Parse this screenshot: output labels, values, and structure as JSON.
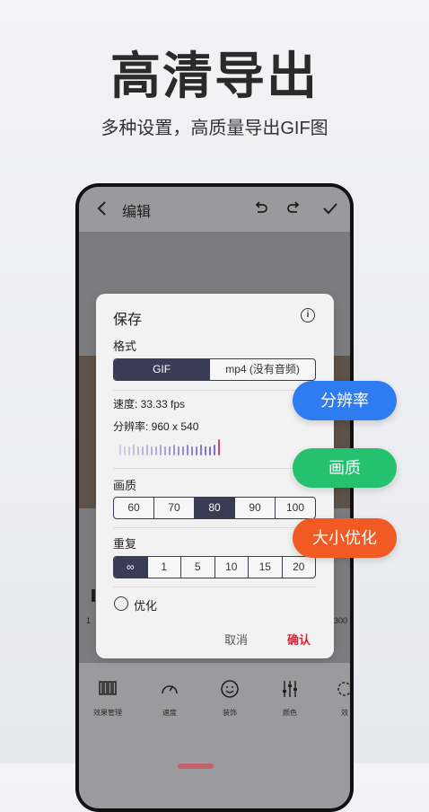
{
  "headline": "高清导出",
  "subheadline": "多种设置，高质量导出GIF图",
  "editor": {
    "title": "编辑",
    "back_icon": "chevron-left-icon",
    "undo_icon": "undo-icon",
    "redo_icon": "redo-icon",
    "confirm_icon": "check-icon",
    "range_start": "1",
    "range_end": "300",
    "tools": [
      {
        "label": "效果管理",
        "icon": "film-strip-icon"
      },
      {
        "label": "速度",
        "icon": "speedometer-icon"
      },
      {
        "label": "装饰",
        "icon": "smiley-icon"
      },
      {
        "label": "颜色",
        "icon": "sliders-icon"
      },
      {
        "label": "效",
        "icon": "effect-icon"
      }
    ]
  },
  "dialog": {
    "title": "保存",
    "format_label": "格式",
    "formats": [
      {
        "label": "GIF",
        "selected": true
      },
      {
        "label": "mp4 (没有音频)",
        "selected": false
      }
    ],
    "speed_text": "速度: 33.33 fps",
    "resolution_text": "分辨率: 960 x 540",
    "quality_label": "画质",
    "quality_options": [
      "60",
      "70",
      "80",
      "90",
      "100"
    ],
    "quality_selected": "80",
    "repeat_label": "重复",
    "repeat_options": [
      "∞",
      "1",
      "5",
      "10",
      "15",
      "20"
    ],
    "repeat_selected": "∞",
    "optimize_label": "优化",
    "optimize_checked": false,
    "cancel_label": "取消",
    "confirm_label": "确认"
  },
  "badges": [
    {
      "label": "分辨率",
      "color": "#2f7bf0"
    },
    {
      "label": "画质",
      "color": "#24c16f"
    },
    {
      "label": "大小优化",
      "color": "#f15a22"
    }
  ],
  "colors": {
    "selected": "#3a3c55",
    "confirm": "#d8263a"
  }
}
